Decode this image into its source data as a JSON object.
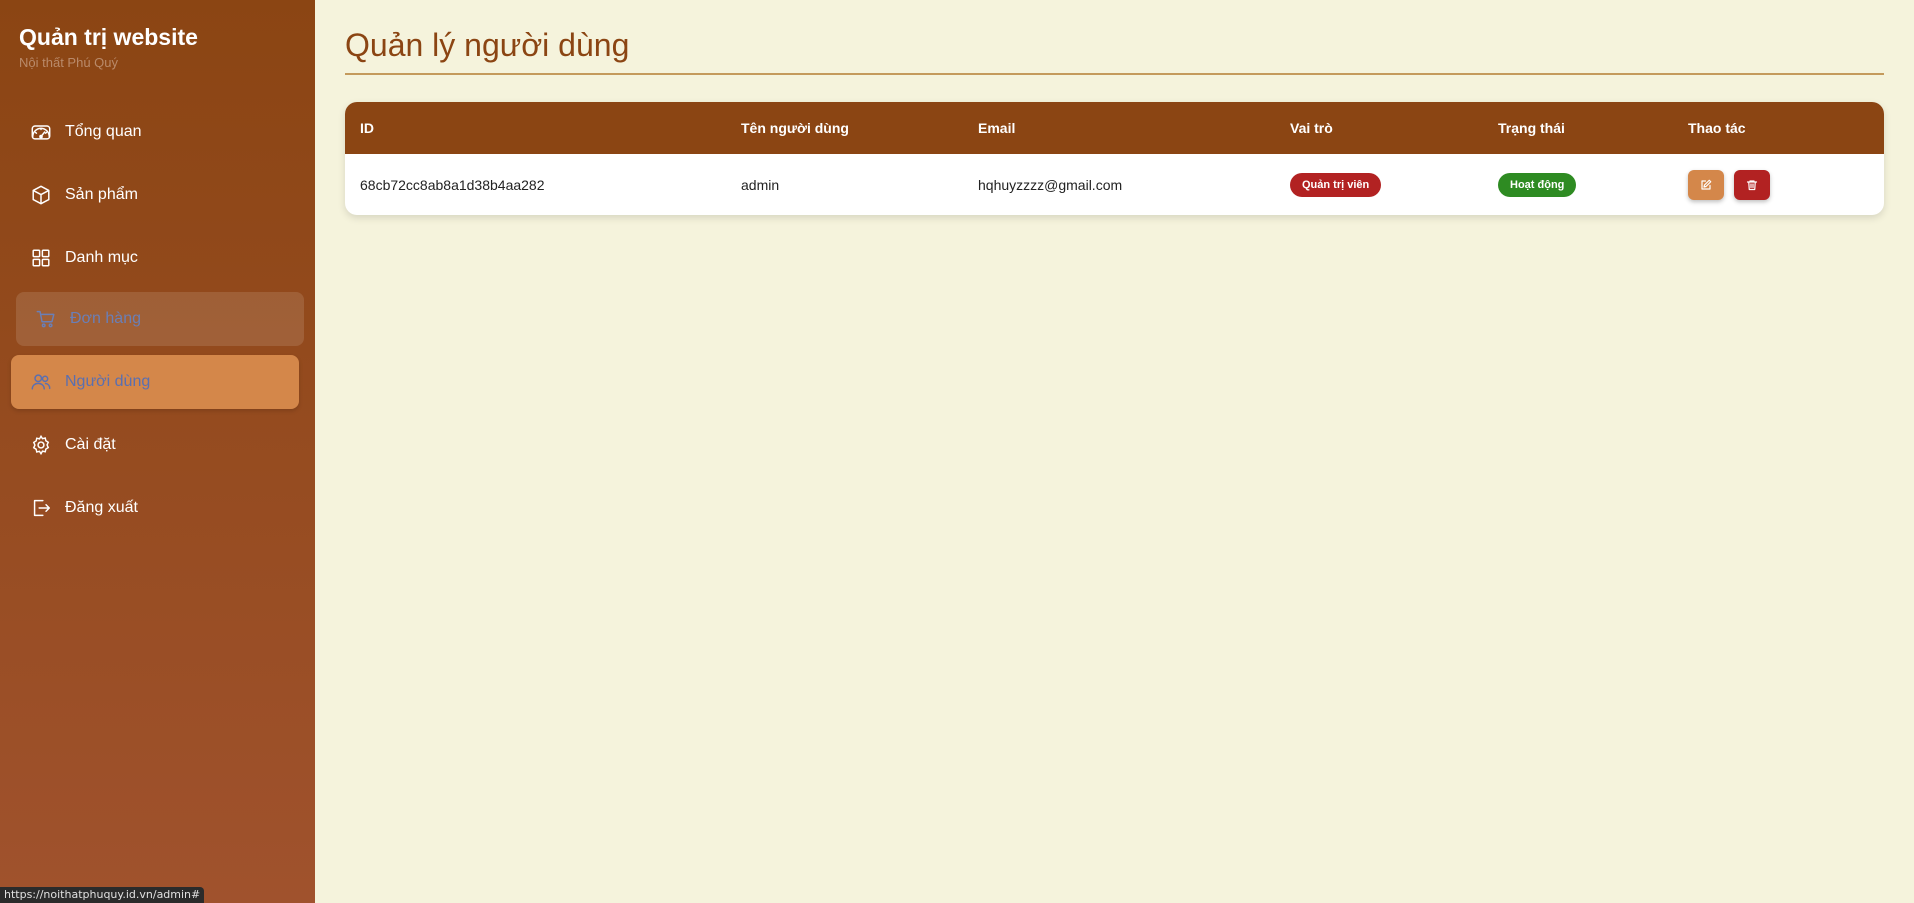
{
  "sidebar": {
    "title": "Quản trị website",
    "subtitle": "Nội thất Phú Quý",
    "items": [
      {
        "label": "Tổng quan",
        "icon": "dashboard-icon"
      },
      {
        "label": "Sản phẩm",
        "icon": "box-icon"
      },
      {
        "label": "Danh mục",
        "icon": "grid-icon"
      },
      {
        "label": "Đơn hàng",
        "icon": "cart-icon"
      },
      {
        "label": "Người dùng",
        "icon": "users-icon"
      },
      {
        "label": "Cài đặt",
        "icon": "gear-icon"
      },
      {
        "label": "Đăng xuất",
        "icon": "logout-icon"
      }
    ]
  },
  "status_url": "https://noithatphuquy.id.vn/admin#",
  "main": {
    "title": "Quản lý người dùng",
    "table": {
      "headers": [
        "ID",
        "Tên người dùng",
        "Email",
        "Vai trò",
        "Trạng thái",
        "Thao tác"
      ],
      "rows": [
        {
          "id": "68cb72cc8ab8a1d38b4aa282",
          "username": "admin",
          "email": "hqhuyzzzz@gmail.com",
          "role": "Quản trị viên",
          "status": "Hoạt động"
        }
      ]
    }
  },
  "colors": {
    "sidebar": "#8b4513",
    "accent": "#d4874a",
    "danger": "#b22222",
    "success": "#2e8b22",
    "background": "#f5f3dc"
  }
}
